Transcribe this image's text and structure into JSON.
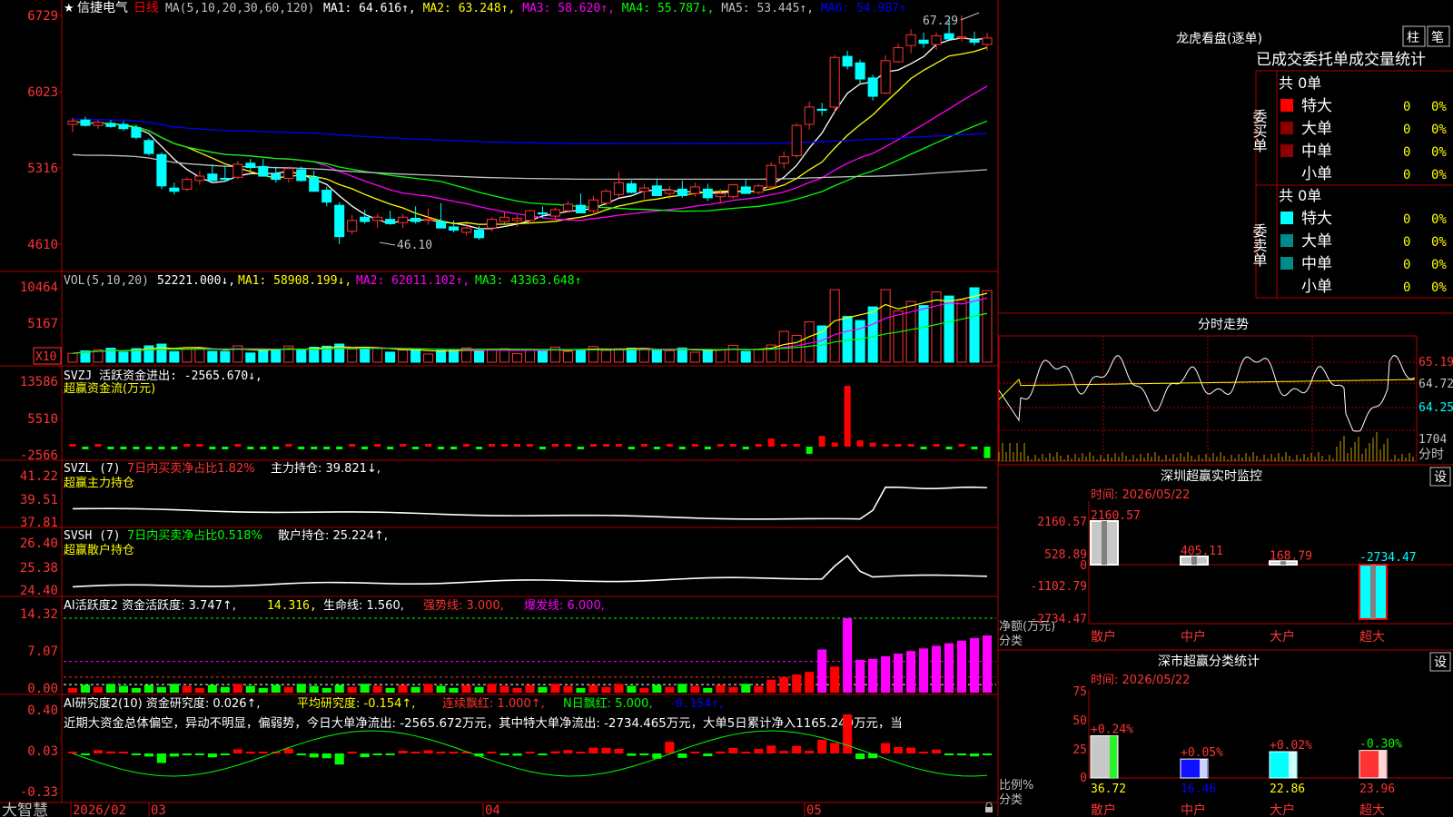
{
  "main": {
    "star": "★",
    "stock_name": "信捷电气",
    "period": "日线",
    "ma_label": "MA(5,10,20,30,60,120)",
    "ma_values": [
      {
        "text": "MA1: 64.616↑,",
        "color": "#ffffff"
      },
      {
        "text": "MA2: 63.248↑,",
        "color": "#ffff00"
      },
      {
        "text": "MA3: 58.620↑,",
        "color": "#ff00ff"
      },
      {
        "text": "MA4: 55.787↓,",
        "color": "#00ff00"
      },
      {
        "text": "MA5: 53.445↑,",
        "color": "#c0c0c0"
      },
      {
        "text": "MA6: 54.987↑",
        "color": "#0000ff"
      }
    ],
    "y_ticks": [
      "6729",
      "6023",
      "5316",
      "4610"
    ],
    "high_label": "67.29",
    "low_label": "46.10"
  },
  "vol": {
    "title": "VOL(5,10,20)",
    "value": "52221.000↓,",
    "ma1": "MA1: 58908.199↓,",
    "ma2": "MA2: 62011.102↑,",
    "ma3": "MA3: 43363.648↑",
    "y_ticks": [
      "10464",
      "5167"
    ],
    "unit": "X10"
  },
  "svzj": {
    "title": "SVZJ  活跃资金进出: -2565.670↓,",
    "subtitle": "超赢资金流(万元)",
    "y_ticks": [
      "13586",
      "5510",
      "-2566"
    ]
  },
  "svzl": {
    "title": "SVZL (7)",
    "pct": "7日内买卖净占比1.82%",
    "hold": "主力持仓: 39.821↓,",
    "subtitle": "超赢主力持仓",
    "y_ticks": [
      "41.22",
      "39.51",
      "37.81"
    ]
  },
  "svsh": {
    "title": "SVSH (7)",
    "pct": "7日内买卖净占比0.518%",
    "hold": "散户持仓: 25.224↑,",
    "subtitle": "超赢散户持仓",
    "y_ticks": [
      "26.40",
      "25.38",
      "24.40"
    ]
  },
  "ai1": {
    "title": "AI活跃度2 资金活跃度: 3.747↑,",
    "v2": "14.316,",
    "v3": "生命线: 1.560,",
    "v4": "强势线: 3.000,",
    "v5": "爆发线: 6.000,",
    "y_ticks": [
      "14.32",
      "7.07",
      "0.00"
    ]
  },
  "ai2": {
    "title": "AI研究度2(10) 资金研究度: 0.026↑,",
    "v2": "平均研究度: -0.154↑,",
    "v3": "连续飘红: 1.000↑,",
    "v4": "N日飘红: 5.000,",
    "v5": "-0.154↑,",
    "comment": "近期大资金总体偏空，异动不明显，偏弱势，今日大单净流出: -2565.672万元，其中特大单净流出: -2734.465万元，大单5日累计净入1165.249万元，当",
    "y_ticks": [
      "0.40",
      "0.03",
      "-0.33"
    ]
  },
  "bottom": {
    "brand": "大智慧",
    "months": [
      "2026/02",
      "03",
      "04",
      "05"
    ]
  },
  "lhb": {
    "title": "龙虎看盘(逐单)",
    "btn1": "柱",
    "btn2": "笔",
    "tabs": "已成交委托单成交量统计",
    "buy_side": "委买单",
    "sell_side": "委卖单",
    "buy_total": "共 0单",
    "sell_total": "共 0单",
    "buy_rows": [
      {
        "label": "特大",
        "count": "0",
        "pct": "0%",
        "color": "#ff0000"
      },
      {
        "label": "大单",
        "count": "0",
        "pct": "0%",
        "color": "#8b0000"
      },
      {
        "label": "中单",
        "count": "0",
        "pct": "0%",
        "color": "#8b0000"
      },
      {
        "label": "小单",
        "count": "0",
        "pct": "0%",
        "color": ""
      }
    ],
    "sell_rows": [
      {
        "label": "特大",
        "count": "0",
        "pct": "0%",
        "color": "#00ffff"
      },
      {
        "label": "大单",
        "count": "0",
        "pct": "0%",
        "color": "#008b8b"
      },
      {
        "label": "中单",
        "count": "0",
        "pct": "0%",
        "color": "#008b8b"
      },
      {
        "label": "小单",
        "count": "0",
        "pct": "0%",
        "color": ""
      }
    ]
  },
  "fenshi": {
    "title": "分时走势",
    "prices": [
      "65.19",
      "64.72",
      "64.25"
    ],
    "vol_label": "1704",
    "unit": "分时"
  },
  "monitor": {
    "title": "深圳超赢实时监控",
    "btn": "设",
    "time": "时间: 2026/05/22",
    "y_ticks": [
      "2160.57",
      "528.89",
      "0",
      "-1102.79",
      "-2734.47"
    ],
    "axis_label": "净额(万元)",
    "axis_label2": "分类",
    "categories": [
      "散户",
      "中户",
      "大户",
      "超大"
    ],
    "bar_values": [
      "2160.57",
      "405.11",
      "168.79",
      "-2734.47"
    ]
  },
  "classify": {
    "title": "深市超赢分类统计",
    "btn": "设",
    "time": "时间: 2026/05/22",
    "y_ticks": [
      "75",
      "50",
      "25",
      "0"
    ],
    "axis_label": "比例%",
    "axis_label2": "分类",
    "categories": [
      "散户",
      "中户",
      "大户",
      "超大"
    ],
    "changes": [
      "+0.24%",
      "+0.05%",
      "+0.02%",
      "-0.30%"
    ],
    "values": [
      "36.72",
      "16.46",
      "22.86",
      "23.96"
    ]
  },
  "chart_data": [
    {
      "type": "candlestick",
      "title": "信捷电气 日线",
      "x": [
        "2026/02",
        "03",
        "04",
        "05"
      ],
      "ylim": [
        46.1,
        67.29
      ],
      "y_ticks": [
        67.29,
        60.23,
        53.16,
        46.1
      ],
      "annotations": [
        {
          "text": "67.29",
          "kind": "high"
        },
        {
          "text": "46.10",
          "kind": "low"
        }
      ],
      "candles": [
        [
          57.2,
          57.8,
          56.5,
          57.5
        ],
        [
          57.6,
          57.9,
          57.0,
          57.1
        ],
        [
          57.1,
          57.6,
          56.8,
          57.4
        ],
        [
          57.3,
          57.6,
          56.9,
          57.0
        ],
        [
          57.2,
          57.5,
          56.6,
          56.8
        ],
        [
          56.9,
          57.2,
          55.8,
          56.0
        ],
        [
          55.7,
          55.9,
          54.3,
          54.5
        ],
        [
          54.4,
          54.6,
          51.2,
          51.5
        ],
        [
          51.3,
          51.8,
          50.7,
          51.0
        ],
        [
          51.2,
          52.3,
          51.0,
          52.1
        ],
        [
          52.0,
          52.9,
          51.6,
          52.4
        ],
        [
          52.6,
          53.5,
          51.9,
          52.0
        ],
        [
          52.2,
          53.4,
          51.9,
          52.1
        ],
        [
          52.3,
          53.8,
          52.1,
          53.5
        ],
        [
          53.6,
          54.0,
          52.9,
          53.2
        ],
        [
          53.3,
          54.0,
          52.8,
          52.4
        ],
        [
          52.6,
          53.3,
          51.8,
          52.1
        ],
        [
          52.2,
          53.3,
          51.8,
          53.1
        ],
        [
          53.0,
          53.3,
          51.9,
          52.0
        ],
        [
          52.3,
          52.9,
          51.6,
          51.0
        ],
        [
          51.1,
          51.4,
          49.6,
          50.0
        ],
        [
          49.7,
          50.0,
          46.1,
          46.8
        ],
        [
          47.3,
          48.8,
          47.0,
          48.3
        ],
        [
          48.6,
          49.3,
          48.0,
          48.2
        ],
        [
          48.3,
          48.9,
          47.6,
          48.6
        ],
        [
          48.4,
          49.2,
          47.9,
          48.0
        ],
        [
          48.1,
          48.9,
          47.6,
          48.6
        ],
        [
          48.5,
          49.6,
          48.0,
          48.2
        ],
        [
          48.3,
          49.4,
          47.9,
          48.4
        ],
        [
          48.2,
          49.9,
          47.8,
          47.6
        ],
        [
          47.7,
          48.3,
          47.2,
          47.4
        ],
        [
          47.2,
          48.0,
          46.9,
          47.6
        ],
        [
          47.4,
          47.8,
          46.5,
          46.7
        ],
        [
          47.6,
          48.6,
          47.3,
          48.4
        ],
        [
          48.2,
          49.1,
          48.0,
          48.6
        ],
        [
          48.3,
          48.8,
          47.7,
          48.5
        ],
        [
          48.3,
          49.3,
          48.0,
          49.2
        ],
        [
          49.0,
          49.6,
          48.5,
          48.9
        ],
        [
          48.7,
          49.5,
          48.4,
          49.3
        ],
        [
          49.2,
          50.1,
          49.0,
          49.8
        ],
        [
          49.7,
          50.8,
          49.4,
          49.0
        ],
        [
          49.2,
          50.6,
          48.8,
          50.2
        ],
        [
          49.9,
          51.2,
          49.6,
          51.0
        ],
        [
          50.7,
          52.8,
          50.4,
          51.8
        ],
        [
          51.7,
          52.0,
          50.8,
          50.9
        ],
        [
          51.0,
          51.7,
          50.3,
          51.3
        ],
        [
          51.5,
          52.2,
          50.8,
          50.6
        ],
        [
          50.8,
          51.5,
          50.3,
          51.1
        ],
        [
          51.2,
          52.0,
          50.4,
          50.6
        ],
        [
          50.8,
          51.8,
          50.5,
          51.4
        ],
        [
          51.2,
          51.7,
          50.1,
          50.4
        ],
        [
          50.5,
          51.2,
          49.9,
          50.8
        ],
        [
          50.5,
          51.7,
          50.3,
          51.6
        ],
        [
          51.4,
          52.1,
          50.9,
          50.8
        ],
        [
          50.9,
          51.7,
          50.7,
          51.5
        ],
        [
          51.4,
          53.7,
          51.3,
          53.4
        ],
        [
          53.6,
          54.7,
          53.1,
          54.2
        ],
        [
          54.3,
          57.3,
          54.1,
          57.1
        ],
        [
          57.2,
          59.3,
          56.7,
          58.8
        ],
        [
          58.6,
          59.2,
          58.0,
          58.5
        ],
        [
          58.8,
          63.6,
          58.2,
          63.4
        ],
        [
          63.5,
          64.0,
          62.3,
          62.6
        ],
        [
          62.9,
          63.2,
          61.0,
          61.4
        ],
        [
          61.5,
          61.8,
          59.4,
          59.8
        ],
        [
          60.1,
          63.6,
          60.0,
          63.1
        ],
        [
          63.0,
          64.7,
          62.9,
          64.3
        ],
        [
          64.5,
          66.0,
          63.8,
          65.5
        ],
        [
          65.0,
          65.7,
          64.3,
          64.7
        ],
        [
          64.6,
          65.7,
          64.1,
          65.4
        ],
        [
          65.6,
          66.9,
          65.0,
          65.1
        ],
        [
          65.2,
          67.29,
          64.9,
          65.3
        ],
        [
          65.0,
          65.8,
          64.5,
          64.8
        ],
        [
          64.6,
          65.7,
          64.0,
          65.2
        ]
      ],
      "series": [
        {
          "name": "MA1",
          "last": 64.616
        },
        {
          "name": "MA2",
          "last": 63.248
        },
        {
          "name": "MA3",
          "last": 58.62
        },
        {
          "name": "MA4",
          "last": 55.787
        },
        {
          "name": "MA5",
          "last": 53.445
        },
        {
          "name": "MA6",
          "last": 54.987
        }
      ]
    },
    {
      "type": "bar",
      "title": "VOL(5,10,20)",
      "ylim": [
        0,
        10464
      ],
      "y_ticks": [
        10464,
        5167
      ],
      "unit": "X10",
      "last": 52221.0,
      "series": [
        {
          "name": "MA1",
          "last": 58908.199
        },
        {
          "name": "MA2",
          "last": 62011.102
        },
        {
          "name": "MA3",
          "last": 43363.648
        }
      ]
    },
    {
      "type": "bar",
      "title": "SVZJ 活跃资金进出",
      "ylabel": "超赢资金流(万元)",
      "ylim": [
        -2566,
        13586
      ],
      "y_ticks": [
        13586,
        5510,
        -2566
      ],
      "last": -2565.67
    },
    {
      "type": "line",
      "title": "SVZL (7)",
      "ylabel": "超赢主力持仓",
      "ylim": [
        37.81,
        41.22
      ],
      "y_ticks": [
        41.22,
        39.51,
        37.81
      ],
      "last": 39.821
    },
    {
      "type": "line",
      "title": "SVSH (7)",
      "ylabel": "超赢散户持仓",
      "ylim": [
        24.4,
        26.4
      ],
      "y_ticks": [
        26.4,
        25.38,
        24.4
      ],
      "last": 25.224
    },
    {
      "type": "bar",
      "title": "AI活跃度2",
      "ylim": [
        0,
        14.32
      ],
      "y_ticks": [
        14.32,
        7.07,
        0.0
      ],
      "last": 3.747,
      "levels": [
        {
          "name": "生命线",
          "value": 1.56
        },
        {
          "name": "强势线",
          "value": 3.0
        },
        {
          "name": "爆发线",
          "value": 6.0
        }
      ]
    },
    {
      "type": "bar",
      "title": "AI研究度2(10)",
      "ylim": [
        -0.33,
        0.4
      ],
      "y_ticks": [
        0.4,
        0.03,
        -0.33
      ],
      "last": 0.026,
      "series": [
        {
          "name": "平均研究度",
          "last": -0.154
        }
      ]
    },
    {
      "type": "bar",
      "title": "深圳超赢实时监控",
      "xlabel": "分类",
      "ylabel": "净额(万元)",
      "categories": [
        "散户",
        "中户",
        "大户",
        "超大"
      ],
      "values": [
        2160.57,
        405.11,
        168.79,
        -2734.47
      ],
      "ylim": [
        -2734.47,
        2160.57
      ]
    },
    {
      "type": "bar",
      "title": "深市超赢分类统计",
      "xlabel": "分类",
      "ylabel": "比例%",
      "categories": [
        "散户",
        "中户",
        "大户",
        "超大"
      ],
      "values": [
        36.72,
        16.46,
        22.86,
        23.96
      ],
      "changes": [
        0.24,
        0.05,
        0.02,
        -0.3
      ],
      "ylim": [
        0,
        75
      ]
    }
  ]
}
